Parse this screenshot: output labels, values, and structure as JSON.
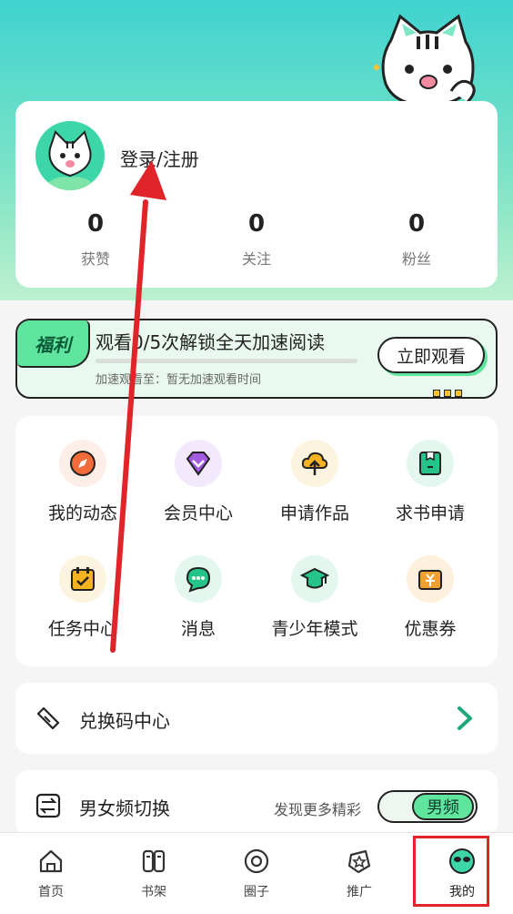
{
  "profile": {
    "login_text": "登录/注册",
    "stats": [
      {
        "value": "0",
        "label": "获赞"
      },
      {
        "value": "0",
        "label": "关注"
      },
      {
        "value": "0",
        "label": "粉丝"
      }
    ]
  },
  "banner": {
    "badge": "福利",
    "title": "观看0/5次解锁全天加速阅读",
    "progress": 0,
    "subtitle": "加速观看至：暂无加速观看时间",
    "button": "立即观看"
  },
  "menu": {
    "items": [
      {
        "label": "我的动态",
        "icon": "compass-icon",
        "color": "#f26b3a"
      },
      {
        "label": "会员中心",
        "icon": "diamond-icon",
        "color": "#a35ce0"
      },
      {
        "label": "申请作品",
        "icon": "cloud-upload-icon",
        "color": "#f5b323"
      },
      {
        "label": "求书申请",
        "icon": "book-box-icon",
        "color": "#25c48a"
      },
      {
        "label": "任务中心",
        "icon": "calendar-check-icon",
        "color": "#f5b323"
      },
      {
        "label": "消息",
        "icon": "chat-bubble-icon",
        "color": "#25c48a"
      },
      {
        "label": "青少年模式",
        "icon": "graduation-cap-icon",
        "color": "#25c48a"
      },
      {
        "label": "优惠券",
        "icon": "coupon-icon",
        "color": "#f0a030"
      }
    ]
  },
  "redeem": {
    "label": "兑换码中心",
    "icon": "ticket-icon"
  },
  "gender_switch": {
    "label": "男女频切换",
    "hint": "发现更多精彩",
    "value": "男频",
    "icon": "switch-icon"
  },
  "tabbar": {
    "tabs": [
      {
        "label": "首页",
        "icon": "home-icon"
      },
      {
        "label": "书架",
        "icon": "bookshelf-icon"
      },
      {
        "label": "圈子",
        "icon": "circle-icon"
      },
      {
        "label": "推广",
        "icon": "promote-star-icon"
      },
      {
        "label": "我的",
        "icon": "me-face-icon",
        "active": true
      }
    ]
  },
  "colors": {
    "accent": "#5fe59e",
    "annotation": "#e0242a"
  }
}
